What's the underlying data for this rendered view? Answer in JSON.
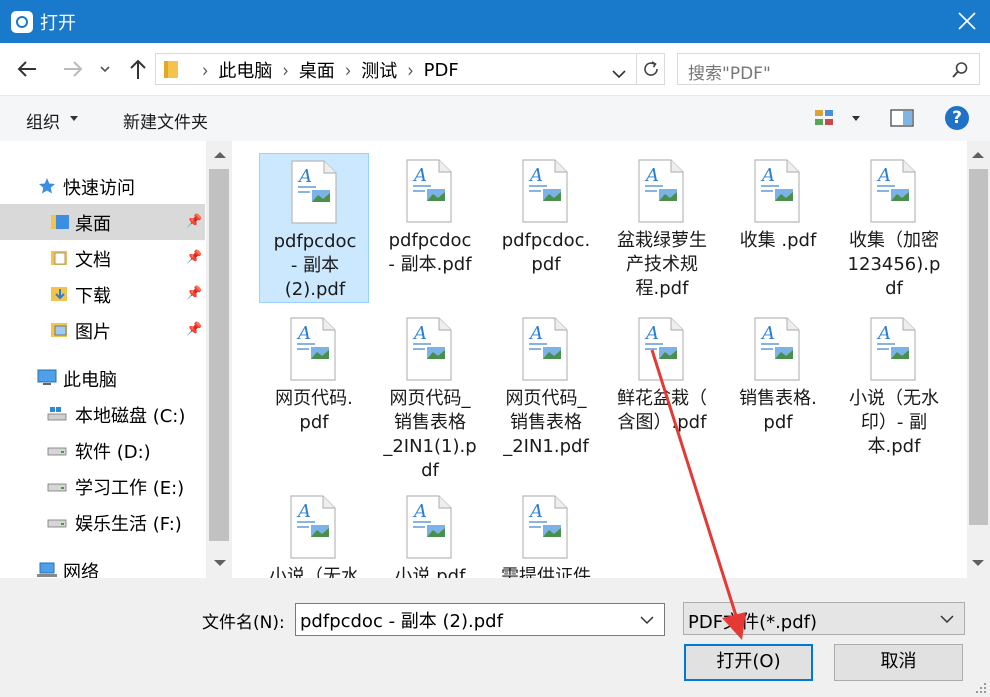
{
  "window": {
    "title": "打开"
  },
  "address": {
    "crumbs": [
      "此电脑",
      "桌面",
      "测试",
      "PDF"
    ]
  },
  "search": {
    "placeholder": "搜索\"PDF\""
  },
  "commandbar": {
    "organize": "组织",
    "new_folder": "新建文件夹"
  },
  "help": {
    "label": "?"
  },
  "nav": {
    "quick_access": "快速访问",
    "desktop": "桌面",
    "documents": "文档",
    "downloads": "下载",
    "pictures": "图片",
    "this_pc": "此电脑",
    "drive_c": "本地磁盘 (C:)",
    "drive_d": "软件 (D:)",
    "drive_e": "学习工作 (E:)",
    "drive_f": "娱乐生活 (F:)",
    "network": "网络"
  },
  "files": [
    "pdfpcdoc - 副本 (2).pdf",
    "pdfpcdoc - 副本.pdf",
    "pdfpcdoc.pdf",
    "盆栽绿萝生产技术规程.pdf",
    "收集 .pdf",
    "收集（加密123456).pdf",
    "网页代码.pdf",
    "网页代码_销售表格_2IN1(1).pdf",
    "网页代码_销售表格_2IN1.pdf",
    "鲜花盆栽（含图）.pdf",
    "销售表格.pdf",
    "小说（无水印）- 副本.pdf",
    "小说（无水",
    "小说.pdf",
    "需提供证件"
  ],
  "file_labels": [
    [
      "pdfpcdoc",
      "- 副本",
      "(2).pdf"
    ],
    [
      "pdfpcdoc",
      "- 副本.pdf"
    ],
    [
      "pdfpcdoc.",
      "pdf"
    ],
    [
      "盆栽绿萝生",
      "产技术规",
      "程.pdf"
    ],
    [
      "收集 .pdf"
    ],
    [
      "收集（加密",
      "123456).p",
      "df"
    ],
    [
      "网页代码.",
      "pdf"
    ],
    [
      "网页代码_",
      "销售表格",
      "_2IN1(1).p",
      "df"
    ],
    [
      "网页代码_",
      "销售表格",
      "_2IN1.pdf"
    ],
    [
      "鲜花盆栽（",
      "含图）.pdf"
    ],
    [
      "销售表格.",
      "pdf"
    ],
    [
      "小说（无水",
      "印）- 副",
      "本.pdf"
    ],
    [
      "小说（无水"
    ],
    [
      "小说.pdf"
    ],
    [
      "需提供证件"
    ]
  ],
  "filename": {
    "label": "文件名(N):",
    "value": "pdfpcdoc - 副本 (2).pdf"
  },
  "filetype": {
    "value": "PDF文件(*.pdf)"
  },
  "buttons": {
    "open": "打开(O)",
    "cancel": "取消"
  },
  "colors": {
    "titlebar": "#1979ca",
    "selection": "#cce8ff",
    "accent": "#0078d7",
    "annotation_arrow": "#e53935"
  }
}
